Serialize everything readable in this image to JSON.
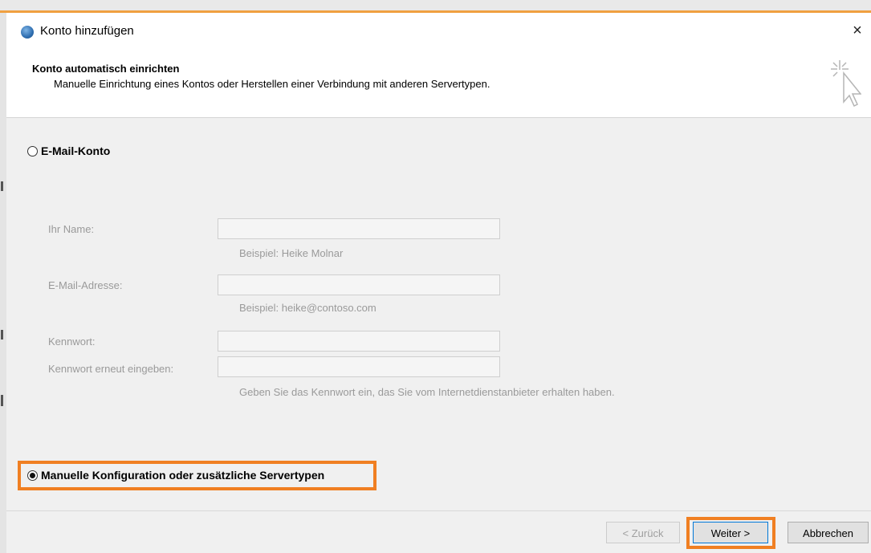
{
  "window": {
    "title": "Konto hinzufügen",
    "close_glyph": "×"
  },
  "header": {
    "title": "Konto automatisch einrichten",
    "subtitle": "Manuelle Einrichtung eines Kontos oder Herstellen einer Verbindung mit anderen Servertypen."
  },
  "options": {
    "email_account": {
      "label": "E-Mail-Konto",
      "selected": false
    },
    "manual_config": {
      "label": "Manuelle Konfiguration oder zusätzliche Servertypen",
      "selected": true
    }
  },
  "fields": {
    "name": {
      "label": "Ihr Name:",
      "value": "",
      "hint": "Beispiel: Heike Molnar"
    },
    "email": {
      "label": "E-Mail-Adresse:",
      "value": "",
      "hint": "Beispiel: heike@contoso.com"
    },
    "password": {
      "label": "Kennwort:",
      "value": ""
    },
    "password_repeat": {
      "label": "Kennwort erneut eingeben:",
      "value": "",
      "hint": "Geben Sie das Kennwort ein, das Sie vom Internetdienstanbieter erhalten haben."
    }
  },
  "buttons": {
    "back": "< Zurück",
    "next": "Weiter >",
    "cancel": "Abbrechen"
  },
  "colors": {
    "highlight": "#f07f22",
    "accent": "#0078d7"
  },
  "icons": [
    "globe-icon",
    "close-icon",
    "wizard-cursor-icon"
  ]
}
